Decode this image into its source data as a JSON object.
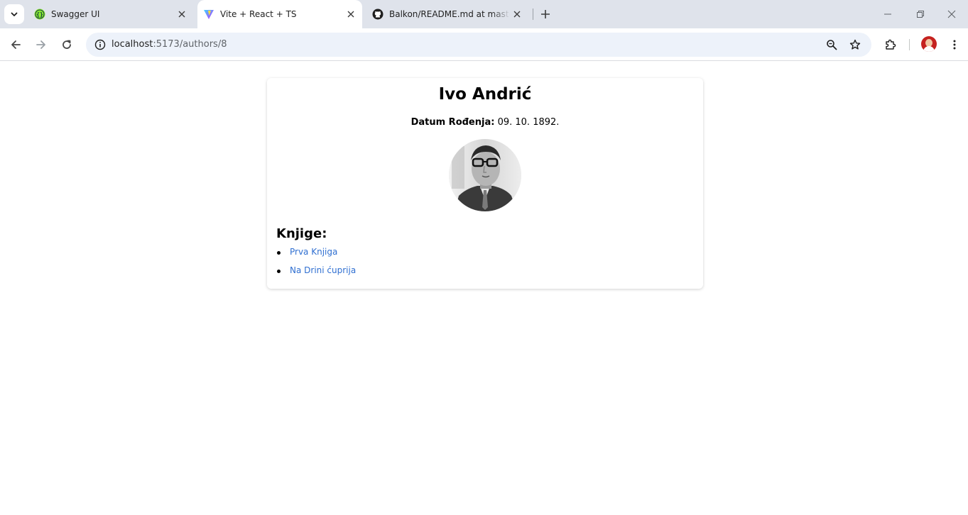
{
  "browser": {
    "tabs": [
      {
        "title": "Swagger UI",
        "favicon": "swagger-icon",
        "active": false
      },
      {
        "title": "Vite + React + TS",
        "favicon": "vite-icon",
        "active": true
      },
      {
        "title": "Balkon/README.md at master ·",
        "favicon": "github-icon",
        "active": false
      }
    ],
    "address": {
      "host": "localhost",
      "path": ":5173/authors/8"
    },
    "colors": {
      "tabstrip": "#dfe3eb",
      "omnibox": "#edf2fa",
      "accent": "#2f6fd1"
    }
  },
  "author": {
    "name": "Ivo Andrić",
    "birth_label": "Datum Rođenja:",
    "birth_value": "09. 10. 1892."
  },
  "books": {
    "heading": "Knjige:",
    "items": [
      {
        "title": "Prva Knjiga"
      },
      {
        "title": "Na Drini ćuprija"
      }
    ]
  }
}
